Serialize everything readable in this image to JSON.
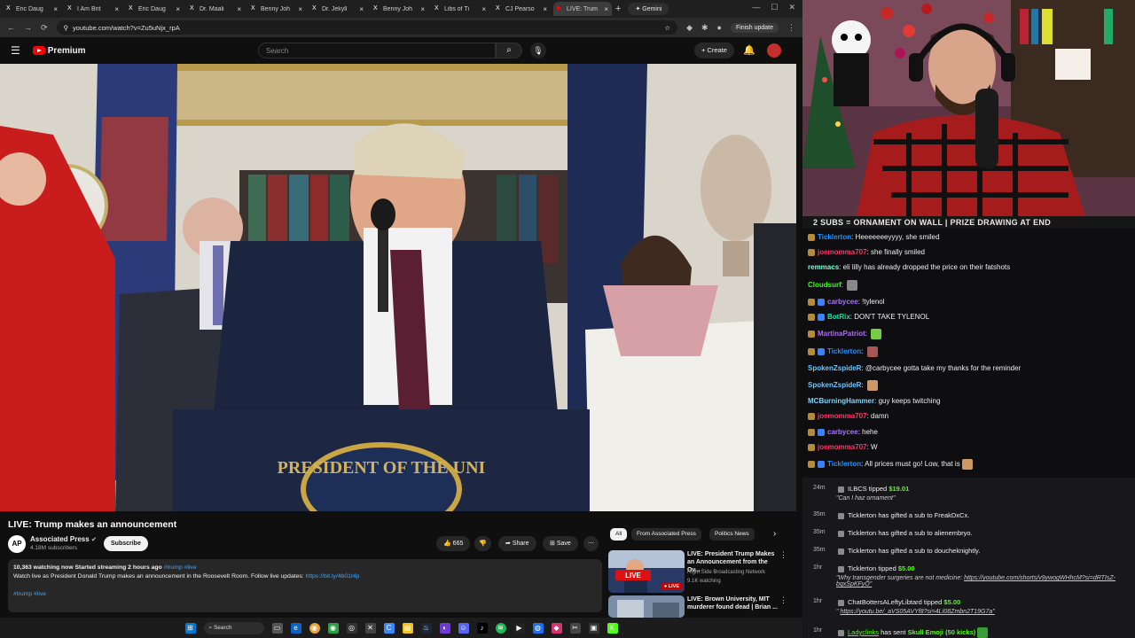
{
  "browser": {
    "tabs": [
      {
        "icon": "X",
        "title": "Eric Daug",
        "color": "#000000"
      },
      {
        "icon": "X",
        "title": "I Am Brit",
        "color": "#000000"
      },
      {
        "icon": "X",
        "title": "Eric Daug",
        "color": "#000000"
      },
      {
        "icon": "X",
        "title": "Dr. Maali",
        "color": "#000000"
      },
      {
        "icon": "X",
        "title": "Benny Joh",
        "color": "#000000"
      },
      {
        "icon": "X",
        "title": "Dr. Jekyll",
        "color": "#000000"
      },
      {
        "icon": "X",
        "title": "Benny Joh",
        "color": "#000000"
      },
      {
        "icon": "X",
        "title": "Libs of Ti",
        "color": "#000000"
      },
      {
        "icon": "X",
        "title": "CJ Pearso",
        "color": "#000000"
      },
      {
        "icon": "▶",
        "title": "LIVE: Trum",
        "color": "#ff0000",
        "active": true
      }
    ],
    "new_tab": "+",
    "gemini": "Gemini",
    "url": "youtube.com/watch?v=Zu5uNjx_rpA",
    "finish_update": "Finish update"
  },
  "youtube": {
    "logo_text": "Premium",
    "search_placeholder": "Search",
    "create_label": "Create",
    "video_title": "LIVE: Trump makes an announcement",
    "channel": {
      "logo": "AP",
      "name": "Associated Press",
      "subscribers": "4.18M subscribers",
      "subscribe_label": "Subscribe"
    },
    "likes": "665",
    "share_label": "Share",
    "save_label": "Save",
    "description": {
      "stats": "10,363 watching now  Started streaming 2 hours ago",
      "stats_tags": "#trump #live",
      "text": "Watch live as President Donald Trump makes an announcement in the Roosevelt Room. Follow live updates:",
      "link": "https://bit.ly/4b01t4p",
      "tags": "#trump #live"
    },
    "chips": [
      "All",
      "From Associated Press",
      "Politics News"
    ],
    "suggestions": [
      {
        "title": "LIVE: President Trump Makes an Announcement from the Ov...",
        "channel": "Right Side Broadcasting Network",
        "meta": "9.1K watching",
        "live": "LIVE",
        "thumb_label": "LIVE"
      },
      {
        "title": "LIVE: Brown University, MIT murderer found dead | Brian ...",
        "channel": "",
        "meta": "",
        "live": "",
        "thumb_label": ""
      }
    ],
    "video_overlay_seal": "PRESIDENT OF THE UNI"
  },
  "taskbar": {
    "search_label": "Search"
  },
  "stream": {
    "banner": "2 SUBS = ORNAMENT ON WALL | PRIZE DRAWING AT END"
  },
  "chat": [
    {
      "user": "Ticklerton",
      "text": "Heeeeeeeyyyy, she smiled",
      "color": "#1e90ff"
    },
    {
      "user": "joemomma707",
      "text": "she finally smiled",
      "color": "#ff3366"
    },
    {
      "user": "remmacs",
      "text": "eli lilly has already dropped the price on their fatshots",
      "color": "#7fffd4"
    },
    {
      "user": "Cloudsurf",
      "text": "",
      "color": "#39ff14"
    },
    {
      "user": "carbycee",
      "text": "!tylenol",
      "color": "#a970ff"
    },
    {
      "user": "BotRix",
      "text": "DON'T TAKE TYLENOL",
      "color": "#00e6a8"
    },
    {
      "user": "MartinaPatriot",
      "text": "",
      "color": "#b266ff"
    },
    {
      "user": "Ticklerton",
      "text": "",
      "color": "#1e90ff"
    },
    {
      "user": "SpokenZspideR",
      "text": "@carbycee gotta take my thanks for the reminder",
      "color": "#6ac6ff"
    },
    {
      "user": "SpokenZspideR",
      "text": "",
      "color": "#6ac6ff"
    },
    {
      "user": "MCBurningHammer",
      "text": "guy keeps twitching",
      "color": "#7dd3fc"
    },
    {
      "user": "joemomma707",
      "text": "damn",
      "color": "#ff3366"
    },
    {
      "user": "carbycee",
      "text": "hehe",
      "color": "#a970ff"
    },
    {
      "user": "joemomma707",
      "text": "W",
      "color": "#ff3366"
    },
    {
      "user": "Ticklerton",
      "text": "All prices must go! Low, that is",
      "color": "#1e90ff"
    }
  ],
  "events": [
    {
      "time": "24m",
      "user": "ILBCS",
      "text": "tipped",
      "amount": "$19.01",
      "sub": "\"Can I haz ornament\"",
      "sub_link": ""
    },
    {
      "time": "35m",
      "user": "Ticklerton",
      "text": "has gifted a sub to",
      "target": "FreakDxCx."
    },
    {
      "time": "35m",
      "user": "Ticklerton",
      "text": "has gifted a sub to",
      "target": "alienembryo."
    },
    {
      "time": "35m",
      "user": "Ticklerton",
      "text": "has gifted a sub to",
      "target": "doucheknightly."
    },
    {
      "time": "1hr",
      "user": "Ticklerton",
      "text": "tipped",
      "amount": "$5.00",
      "sub": "\"Why transgender surgeries are not medicine:",
      "sub_link": "https://youtube.com/shorts/v9ywogWHhcM?si=dRTIsZ-bqxSpKFyO\""
    },
    {
      "time": "1hr",
      "user": "ChatBottersALeftyLibtard",
      "text": "tipped",
      "amount": "$5.00",
      "sub": "\"",
      "sub_link": "https://youtu.be/_aVS05AVYf8?si=4LI08Zmbn2T19G7a\""
    },
    {
      "time": "1hr",
      "user": "Ladyclinks",
      "text": "has sent",
      "amount": "Skull Emoji (50 kicks)"
    }
  ]
}
